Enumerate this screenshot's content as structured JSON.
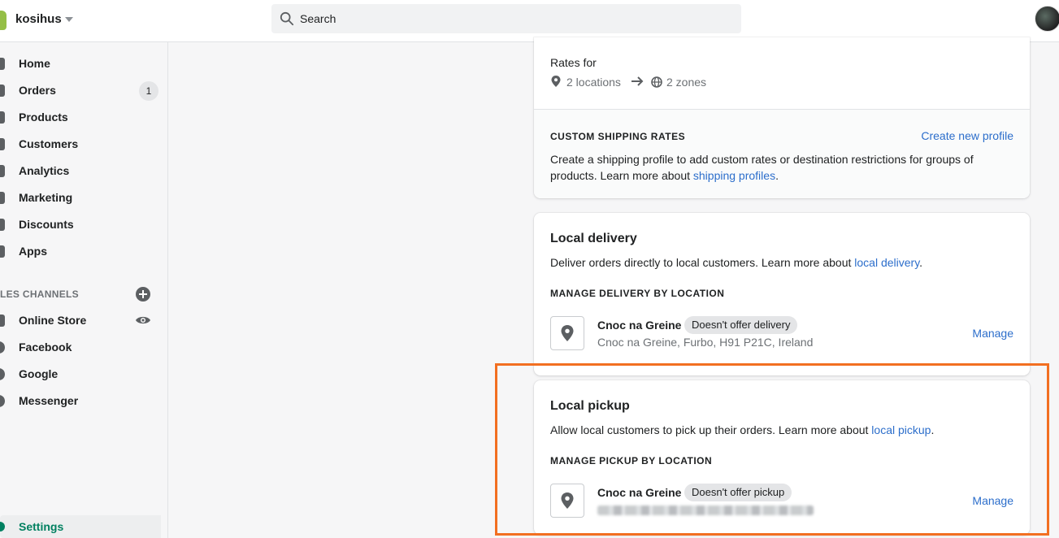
{
  "header": {
    "store_name": "kosihus",
    "search_placeholder": "Search"
  },
  "sidebar": {
    "items": [
      {
        "label": "Home",
        "icon": "home-icon"
      },
      {
        "label": "Orders",
        "icon": "orders-icon",
        "badge": "1"
      },
      {
        "label": "Products",
        "icon": "tag-icon"
      },
      {
        "label": "Customers",
        "icon": "customer-icon"
      },
      {
        "label": "Analytics",
        "icon": "analytics-icon"
      },
      {
        "label": "Marketing",
        "icon": "megaphone-icon"
      },
      {
        "label": "Discounts",
        "icon": "discount-icon"
      },
      {
        "label": "Apps",
        "icon": "apps-icon"
      }
    ],
    "channels_title": "LES CHANNELS",
    "channels": [
      {
        "label": "Online Store",
        "icon": "store-icon"
      },
      {
        "label": "Facebook",
        "icon": "facebook-icon"
      },
      {
        "label": "Google",
        "icon": "google-icon"
      },
      {
        "label": "Messenger",
        "icon": "messenger-icon"
      }
    ],
    "settings_label": "Settings"
  },
  "general_rates": {
    "rates_for": "Rates for",
    "locations": "2 locations",
    "zones": "2 zones"
  },
  "custom_rates": {
    "title": "CUSTOM SHIPPING RATES",
    "create_link": "Create new profile",
    "desc_prefix": "Create a shipping profile to add custom rates or destination restrictions for groups of",
    "desc_line2": "products. Learn more about",
    "desc_link": "shipping profiles",
    "desc_suffix": "."
  },
  "local_delivery": {
    "title": "Local delivery",
    "desc": "Deliver orders directly to local customers. Learn more about",
    "desc_link": "local delivery",
    "desc_suffix": ".",
    "manage_title": "MANAGE DELIVERY BY LOCATION",
    "location_name": "Cnoc na Greine",
    "status": "Doesn't offer delivery",
    "address": "Cnoc na Greine, Furbo, H91 P21C, Ireland",
    "manage": "Manage"
  },
  "local_pickup": {
    "title": "Local pickup",
    "desc": "Allow local customers to pick up their orders. Learn more about",
    "desc_link": "local pickup",
    "desc_suffix": ".",
    "manage_title": "MANAGE PICKUP BY LOCATION",
    "location_name": "Cnoc na Greine",
    "status": "Doesn't offer pickup",
    "manage": "Manage"
  },
  "colors": {
    "accent": "#2c6ecb",
    "highlight": "#f26f21",
    "settings_active": "#008060"
  }
}
